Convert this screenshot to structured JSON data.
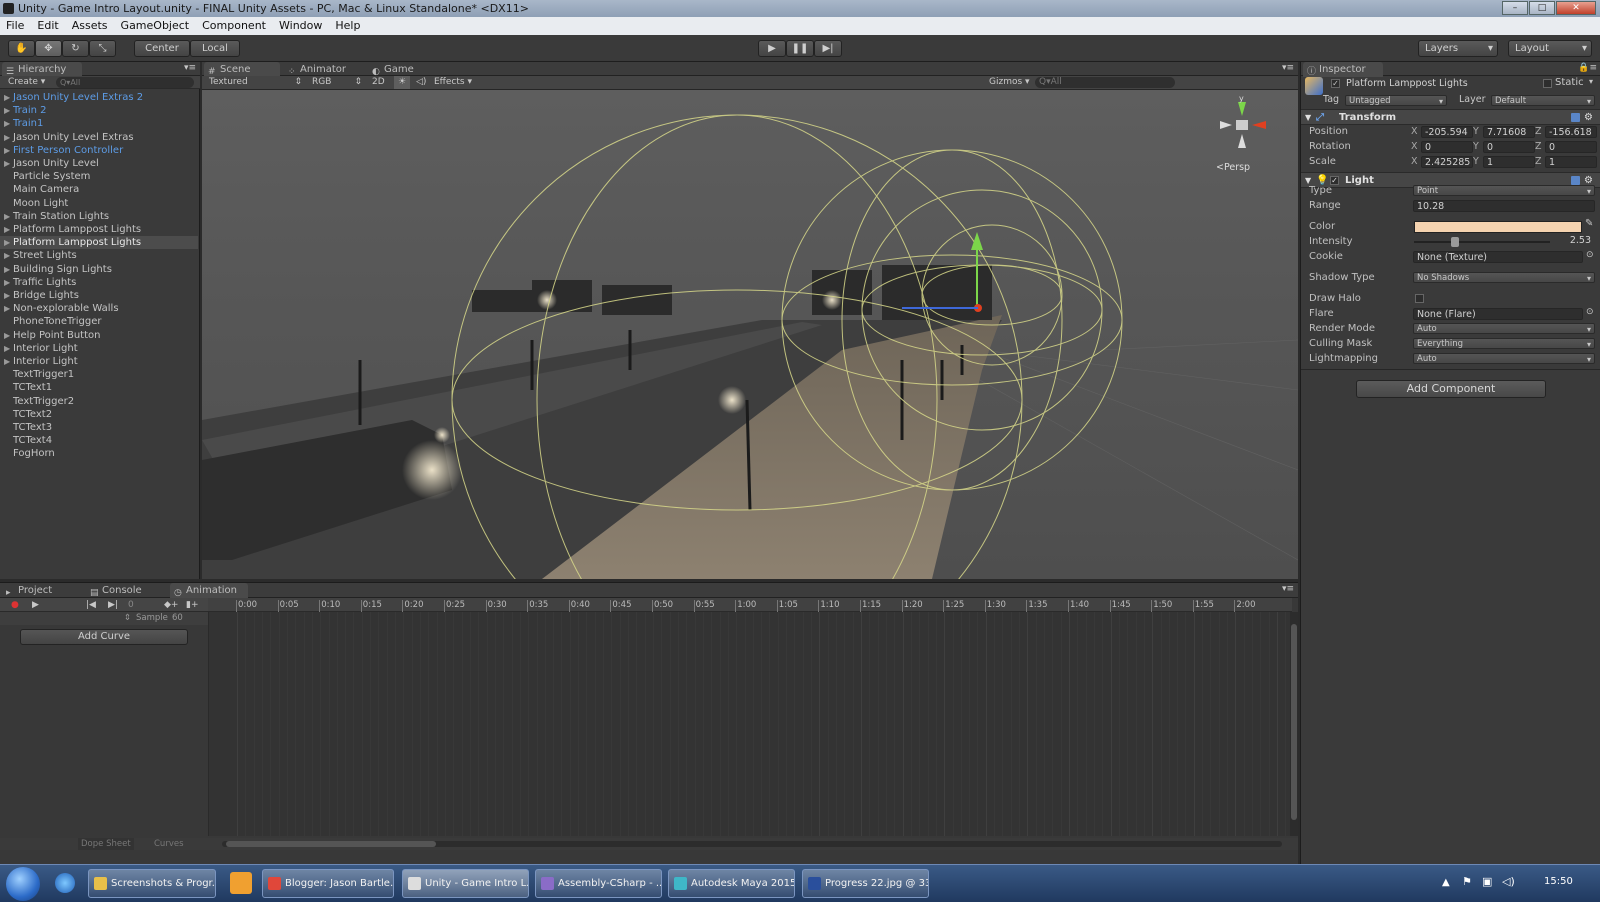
{
  "window": {
    "title": "Unity - Game Intro Layout.unity - FINAL Unity Assets - PC, Mac & Linux Standalone* <DX11>",
    "controls": [
      "minimize-icon",
      "maximize-icon",
      "close-icon"
    ]
  },
  "menu": [
    "File",
    "Edit",
    "Assets",
    "GameObject",
    "Component",
    "Window",
    "Help"
  ],
  "toolbar": {
    "tools": [
      "hand-icon",
      "move-icon",
      "rotate-icon",
      "scale-icon"
    ],
    "pivot": "Center",
    "space": "Local",
    "play_icons": [
      "play-icon",
      "pause-icon",
      "step-icon"
    ],
    "layers": "Layers",
    "layout": "Layout"
  },
  "hierarchy": {
    "tab": "Hierarchy",
    "create": "Create",
    "search": "Q▾All",
    "items": [
      {
        "label": "Jason Unity Level Extras 2",
        "arrow": true,
        "blue": true
      },
      {
        "label": "Train 2",
        "arrow": true,
        "blue": true
      },
      {
        "label": "Train1",
        "arrow": true,
        "blue": true
      },
      {
        "label": "Jason Unity Level Extras",
        "arrow": true,
        "blue": false
      },
      {
        "label": "First Person Controller",
        "arrow": true,
        "blue": true
      },
      {
        "label": "Jason Unity Level",
        "arrow": true,
        "blue": false
      },
      {
        "label": "Particle System",
        "arrow": false,
        "blue": false
      },
      {
        "label": "Main Camera",
        "arrow": false,
        "blue": false
      },
      {
        "label": "Moon Light",
        "arrow": false,
        "blue": false
      },
      {
        "label": "Train Station Lights",
        "arrow": true,
        "blue": false
      },
      {
        "label": "Platform Lamppost Lights",
        "arrow": true,
        "blue": false
      },
      {
        "label": "Platform Lamppost Lights",
        "arrow": true,
        "blue": false,
        "selected": true
      },
      {
        "label": "Street Lights",
        "arrow": true,
        "blue": false
      },
      {
        "label": "Building Sign Lights",
        "arrow": true,
        "blue": false
      },
      {
        "label": "Traffic Lights",
        "arrow": true,
        "blue": false
      },
      {
        "label": "Bridge Lights",
        "arrow": true,
        "blue": false
      },
      {
        "label": "Non-explorable Walls",
        "arrow": true,
        "blue": false
      },
      {
        "label": "PhoneToneTrigger",
        "arrow": false,
        "blue": false
      },
      {
        "label": "Help Point Button",
        "arrow": true,
        "blue": false
      },
      {
        "label": "Interior Light",
        "arrow": true,
        "blue": false
      },
      {
        "label": "Interior Light",
        "arrow": true,
        "blue": false
      },
      {
        "label": "TextTrigger1",
        "arrow": false,
        "blue": false
      },
      {
        "label": "TCText1",
        "arrow": false,
        "blue": false
      },
      {
        "label": "TextTrigger2",
        "arrow": false,
        "blue": false
      },
      {
        "label": "TCText2",
        "arrow": false,
        "blue": false
      },
      {
        "label": "TCText3",
        "arrow": false,
        "blue": false
      },
      {
        "label": "TCText4",
        "arrow": false,
        "blue": false
      },
      {
        "label": "FogHorn",
        "arrow": false,
        "blue": false
      }
    ]
  },
  "scene": {
    "tabs": [
      "Scene",
      "Animator",
      "Game"
    ],
    "shading": "Textured",
    "render": "RGB",
    "mode2d": "2D",
    "effects": "Effects",
    "gizmos": "Gizmos",
    "search": "Q▾All",
    "persp": "Persp",
    "axis_y": "y"
  },
  "inspector": {
    "tab": "Inspector",
    "object_name": "Platform Lamppost Lights",
    "static": "Static",
    "tag_label": "Tag",
    "tag": "Untagged",
    "layer_label": "Layer",
    "layer": "Default",
    "transform": {
      "title": "Transform",
      "position": {
        "label": "Position",
        "x": "-205.594",
        "y": "7.71608",
        "z": "-156.618"
      },
      "rotation": {
        "label": "Rotation",
        "x": "0",
        "y": "0",
        "z": "0"
      },
      "scale": {
        "label": "Scale",
        "x": "2.425285",
        "y": "1",
        "z": "1"
      }
    },
    "light": {
      "title": "Light",
      "type_label": "Type",
      "type": "Point",
      "range_label": "Range",
      "range": "10.28",
      "color_label": "Color",
      "color": "#f5d3b0",
      "intensity_label": "Intensity",
      "intensity": "2.53",
      "intensity_fraction": 0.3,
      "cookie_label": "Cookie",
      "cookie": "None (Texture)",
      "shadow_label": "Shadow Type",
      "shadow": "No Shadows",
      "halo_label": "Draw Halo",
      "flare_label": "Flare",
      "flare": "None (Flare)",
      "render_label": "Render Mode",
      "render": "Auto",
      "culling_label": "Culling Mask",
      "culling": "Everything",
      "lightmap_label": "Lightmapping",
      "lightmap": "Auto"
    },
    "add_component": "Add Component"
  },
  "animation": {
    "tabs": [
      "Project",
      "Console",
      "Animation"
    ],
    "frame": "0",
    "sample_label": "Sample",
    "sample": "60",
    "add_curve": "Add Curve",
    "dope_sheet": "Dope Sheet",
    "curves": "Curves",
    "ticks": [
      "0:00",
      "0:05",
      "0:10",
      "0:15",
      "0:20",
      "0:25",
      "0:30",
      "0:35",
      "0:40",
      "0:45",
      "0:50",
      "0:55",
      "1:00",
      "1:05",
      "1:10",
      "1:15",
      "1:20",
      "1:25",
      "1:30",
      "1:35",
      "1:40",
      "1:45",
      "1:50",
      "1:55",
      "2:00"
    ]
  },
  "taskbar": {
    "items": [
      {
        "label": "Screenshots & Progr...",
        "color": "#e8c04a"
      },
      {
        "label": "Blogger: Jason Bartle...",
        "color": "#e0473a"
      },
      {
        "label": "Unity - Game Intro L...",
        "color": "#dddddd"
      },
      {
        "label": "Assembly-CSharp - ...",
        "color": "#8a6cc7"
      },
      {
        "label": "Autodesk Maya 2015...",
        "color": "#3fb7c8"
      },
      {
        "label": "Progress 22.jpg @ 33...",
        "color": "#2a4f9c"
      }
    ],
    "clock": "15:50"
  }
}
